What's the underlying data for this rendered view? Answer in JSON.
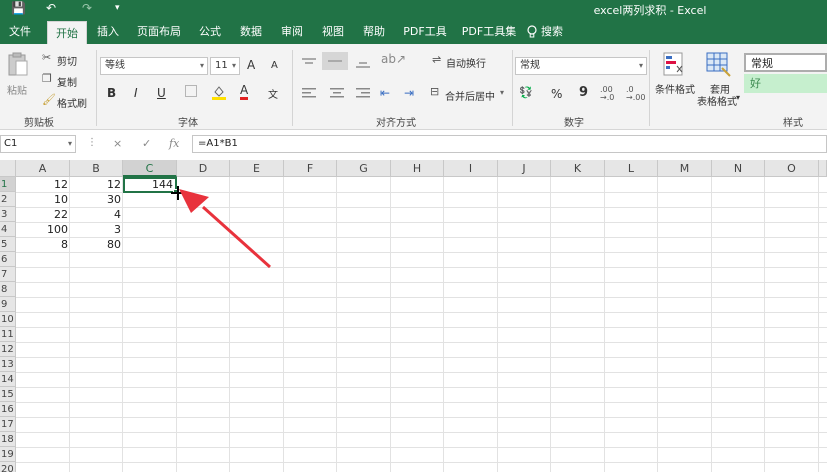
{
  "title_bar": {
    "title": "excel两列求积 - Excel",
    "qa_save": "💾",
    "qa_undo": "↶",
    "qa_redo": "↷",
    "qa_more": "▾"
  },
  "tabs": [
    {
      "label": "文件"
    },
    {
      "label": "开始"
    },
    {
      "label": "插入"
    },
    {
      "label": "页面布局"
    },
    {
      "label": "公式"
    },
    {
      "label": "数据"
    },
    {
      "label": "审阅"
    },
    {
      "label": "视图"
    },
    {
      "label": "帮助"
    },
    {
      "label": "PDF工具"
    },
    {
      "label": "PDF工具集"
    },
    {
      "label": "搜索"
    }
  ],
  "ribbon": {
    "clipboard": {
      "paste": "粘贴",
      "cut": "剪切",
      "copy": "复制",
      "format_painter": "格式刷",
      "group": "剪贴板"
    },
    "font": {
      "name": "等线",
      "size": "11",
      "grow": "A",
      "shrink": "A",
      "bold": "B",
      "italic": "I",
      "underline": "U",
      "font_color": "A",
      "phonetic": "文",
      "group": "字体"
    },
    "alignment": {
      "wrap": "自动换行",
      "merge": "合并后居中",
      "group": "对齐方式"
    },
    "number": {
      "format": "常规",
      "percent": "%",
      "comma": "9",
      "group": "数字"
    },
    "styles": {
      "conditional": "条件格式",
      "table_format_1": "套用",
      "table_format_2": "表格格式",
      "normal": "常规",
      "good": "好",
      "group": "样式"
    }
  },
  "formula_bar": {
    "name_box": "C1",
    "cancel": "×",
    "enter": "✓",
    "fx": "fx",
    "formula": "=A1*B1"
  },
  "columns": [
    "A",
    "B",
    "C",
    "D",
    "E",
    "F",
    "G",
    "H",
    "I",
    "J",
    "K",
    "L",
    "M",
    "N",
    "O"
  ],
  "rows": [
    "1",
    "2",
    "3",
    "4",
    "5",
    "6",
    "7",
    "8",
    "9",
    "10",
    "11",
    "12",
    "13",
    "14",
    "15",
    "16",
    "17",
    "18",
    "19",
    "20"
  ],
  "cells": {
    "A": [
      "12",
      "10",
      "22",
      "100",
      "8"
    ],
    "B": [
      "12",
      "30",
      "4",
      "3",
      "80"
    ],
    "C": [
      "144"
    ]
  },
  "colors": {
    "excel_green": "#217346",
    "arrow_red": "#e8323c"
  }
}
